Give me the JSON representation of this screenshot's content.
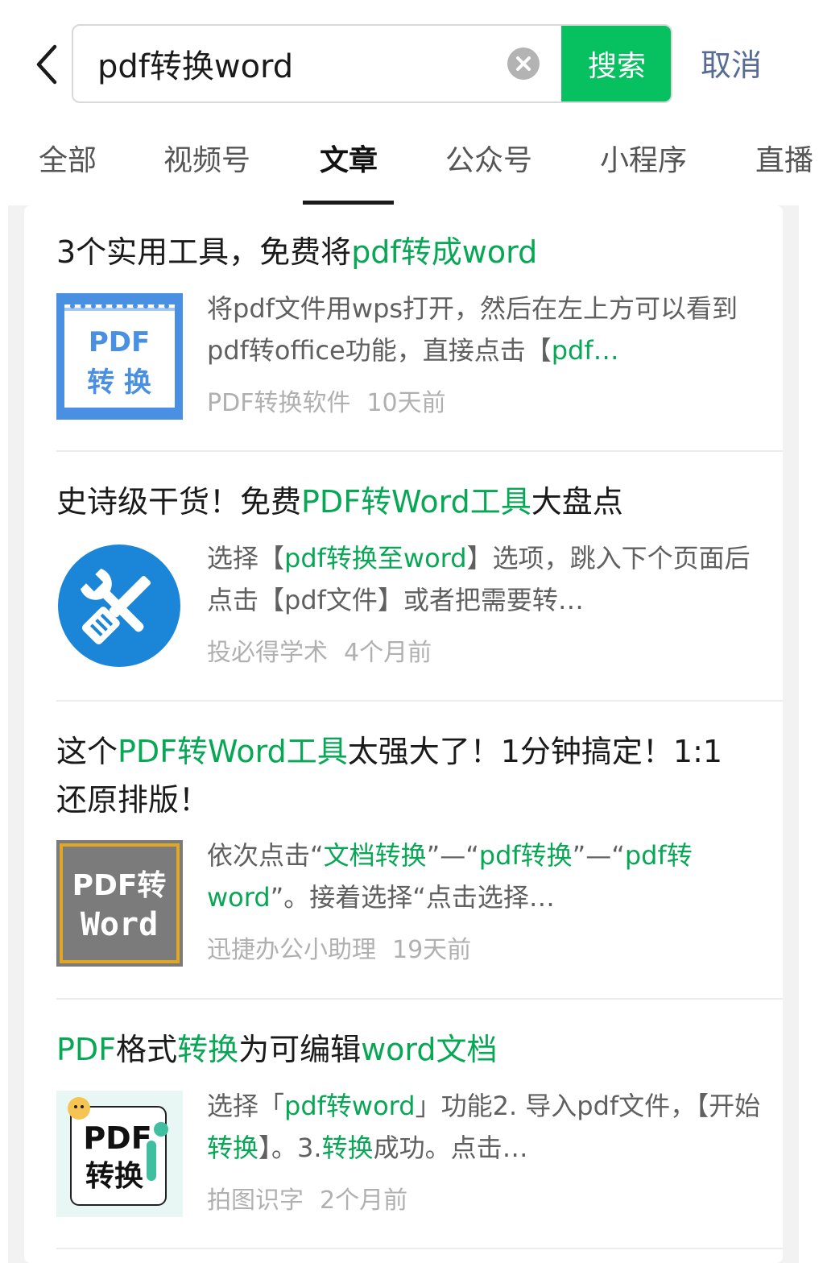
{
  "search": {
    "query": "pdf转换word",
    "button_label": "搜索",
    "cancel_label": "取消"
  },
  "tabs": [
    {
      "label": "全部"
    },
    {
      "label": "视频号"
    },
    {
      "label": "文章",
      "active": true
    },
    {
      "label": "公众号"
    },
    {
      "label": "小程序"
    },
    {
      "label": "直播"
    }
  ],
  "colors": {
    "accent": "#07c160",
    "highlight": "#07a755",
    "cancel": "#576b95"
  },
  "results": [
    {
      "title": [
        {
          "t": "3个实用工具，免费将"
        },
        {
          "t": "pdf转成word",
          "hl": true
        }
      ],
      "desc": [
        {
          "t": "将pdf文件用wps打开，然后在左上方可以看到pdf转office功能，直接点击【"
        },
        {
          "t": "pdf…",
          "hl": true
        }
      ],
      "source": "PDF转换软件",
      "time": "10天前",
      "thumb": {
        "line1": "PDF",
        "line2": "转 换"
      }
    },
    {
      "title": [
        {
          "t": "史诗级干货！免费"
        },
        {
          "t": "PDF转Word工具",
          "hl": true
        },
        {
          "t": "大盘点"
        }
      ],
      "desc": [
        {
          "t": "选择【"
        },
        {
          "t": "pdf转换至word",
          "hl": true
        },
        {
          "t": "】选项，跳入下个页面后点击【pdf文件】或者把需要转…"
        }
      ],
      "source": "投必得学术",
      "time": "4个月前",
      "thumb": {
        "icon": "tools-icon"
      }
    },
    {
      "title": [
        {
          "t": "这个"
        },
        {
          "t": "PDF转Word工具",
          "hl": true
        },
        {
          "t": "太强大了！1分钟搞定！1:1还原排版！"
        }
      ],
      "desc": [
        {
          "t": "依次点击“"
        },
        {
          "t": "文档转换",
          "hl": true
        },
        {
          "t": "”—“"
        },
        {
          "t": "pdf转换",
          "hl": true
        },
        {
          "t": "”—“"
        },
        {
          "t": "pdf转word",
          "hl": true
        },
        {
          "t": "”。接着选择“点击选择…"
        }
      ],
      "source": "迅捷办公小助理",
      "time": "19天前",
      "thumb": {
        "line1": "PDF转",
        "line2": "Word"
      }
    },
    {
      "title": [
        {
          "t": "PDF",
          "hl": true
        },
        {
          "t": "格式"
        },
        {
          "t": "转换",
          "hl": true
        },
        {
          "t": "为可编辑"
        },
        {
          "t": "word文档",
          "hl": true
        }
      ],
      "desc": [
        {
          "t": "选择「"
        },
        {
          "t": "pdf转word",
          "hl": true
        },
        {
          "t": "」功能2. 导入pdf文件，【开始"
        },
        {
          "t": "转换",
          "hl": true
        },
        {
          "t": "】。3."
        },
        {
          "t": "转换",
          "hl": true
        },
        {
          "t": "成功。点击…"
        }
      ],
      "source": "拍图识字",
      "time": "2个月前",
      "thumb": {
        "line1": "PDF",
        "line2": "转换"
      }
    }
  ]
}
